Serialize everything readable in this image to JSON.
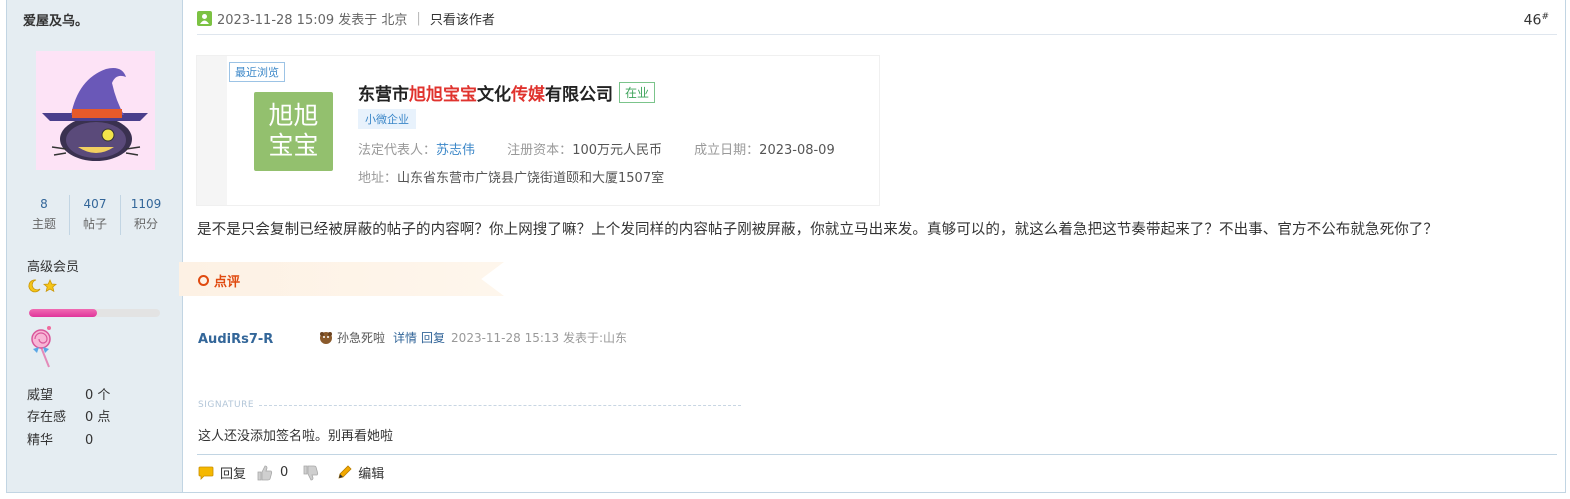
{
  "author": {
    "name": "爱屋及乌。",
    "stats": [
      {
        "num": "8",
        "label": "主题"
      },
      {
        "num": "407",
        "label": "帖子"
      },
      {
        "num": "1109",
        "label": "积分"
      }
    ],
    "group": "高级会员",
    "level_progress_pct": 52,
    "attributes": [
      {
        "key": "威望",
        "value": "0 个"
      },
      {
        "key": "存在感",
        "value": "0 点"
      },
      {
        "key": "精华",
        "value": "0"
      }
    ]
  },
  "post": {
    "time": "2023-11-28 15:09 发表于 北京",
    "only_author": "只看该作者",
    "floor": "46",
    "floor_mark": "#",
    "body": "是不是只会复制已经被屏蔽的帖子的内容啊？你上网搜了嘛？上个发同样的内容帖子刚被屏蔽，你就立马出来发。真够可以的，就这么着急把这节奏带起来了？不出事、官方不公布就急死你了？"
  },
  "company_card": {
    "tag": "最近浏览",
    "logo_text_1": "旭旭",
    "logo_text_2": "宝宝",
    "name_1": "东营市",
    "name_hl_1": "旭旭宝宝",
    "name_2": "文化",
    "name_hl_2": "传媒",
    "name_3": "有限公司",
    "status": "在业",
    "badge": "小微企业",
    "rep_label": "法定代表人：",
    "rep_value": "苏志伟",
    "capital_label": "注册资本：",
    "capital_value": "100万元人民币",
    "date_label": "成立日期：",
    "date_value": "2023-08-09",
    "addr_label": "地址：",
    "addr_value": "山东省东营市广饶县广饶街道颐和大厦1507室"
  },
  "comment": {
    "label": "点评",
    "user": "AudiRs7-R",
    "text": "孙急死啦",
    "detail": "详情",
    "reply": "回复",
    "meta": "2023-11-28 15:13 发表于:山东"
  },
  "signature": {
    "label": "SIGNATURE",
    "text": "这人还没添加签名啦。别再看她啦"
  },
  "actions": {
    "reply": "回复",
    "like_count": "0",
    "edit": "编辑"
  }
}
